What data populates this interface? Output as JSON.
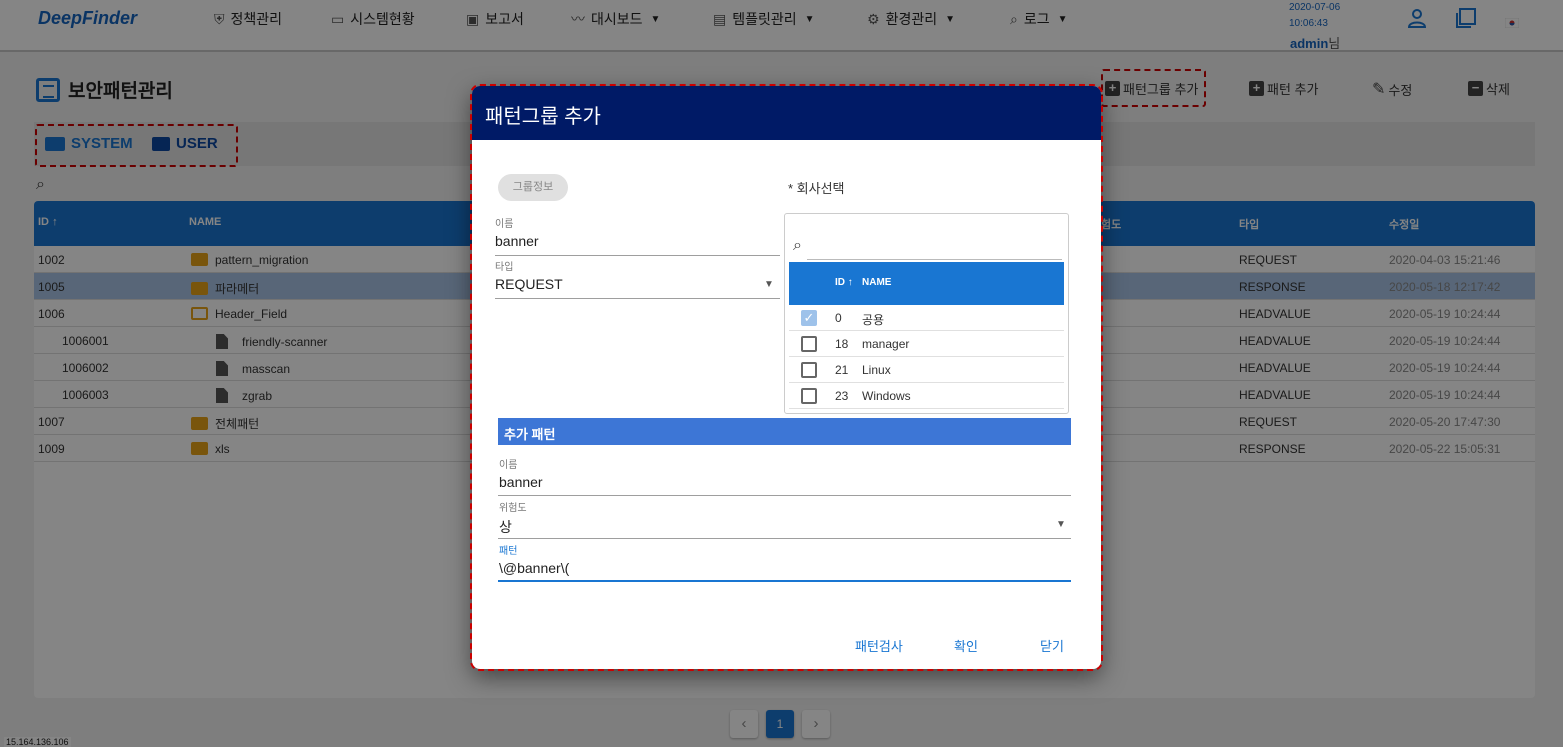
{
  "app": {
    "logo": "DeepFinder"
  },
  "nav": [
    {
      "label": "정책관리",
      "icon": "shield-icon",
      "glyph": "⛨",
      "caret": false
    },
    {
      "label": "시스템현황",
      "icon": "monitor-icon",
      "glyph": "▭",
      "caret": false
    },
    {
      "label": "보고서",
      "icon": "clipboard-check-icon",
      "glyph": "▣",
      "caret": false
    },
    {
      "label": "대시보드",
      "icon": "trend-icon",
      "glyph": "〰",
      "caret": true
    },
    {
      "label": "템플릿관리",
      "icon": "template-icon",
      "glyph": "▤",
      "caret": true
    },
    {
      "label": "환경관리",
      "icon": "gear-icon",
      "glyph": "⚙",
      "caret": true
    },
    {
      "label": "로그",
      "icon": "search-icon",
      "glyph": "⌕",
      "caret": true
    }
  ],
  "header": {
    "date": "2020-07-06",
    "time": "10:06:43",
    "user": "admin",
    "user_suffix": "님"
  },
  "page": {
    "title": "보안패턴관리"
  },
  "actions": {
    "add_group": "패턴그룹 추가",
    "add_pattern": "패턴 추가",
    "edit": "수정",
    "delete": "삭제"
  },
  "tabs": {
    "system": "SYSTEM",
    "user": "USER"
  },
  "table": {
    "columns": {
      "id": "ID",
      "name": "NAME",
      "risk": "험도",
      "type": "타입",
      "modified": "수정일"
    },
    "rows": [
      {
        "id": "1002",
        "name": "pattern_migration",
        "type": "REQUEST",
        "modified": "2020-04-03 15:21:46",
        "kind": "folder",
        "level": 0,
        "selected": false
      },
      {
        "id": "1005",
        "name": "파라메터",
        "type": "RESPONSE",
        "modified": "2020-05-18 12:17:42",
        "kind": "folder",
        "level": 0,
        "selected": true
      },
      {
        "id": "1006",
        "name": "Header_Field",
        "type": "HEADVALUE",
        "modified": "2020-05-19 10:24:44",
        "kind": "folder-open",
        "level": 0,
        "selected": false
      },
      {
        "id": "1006001",
        "name": "friendly-scanner",
        "type": "HEADVALUE",
        "modified": "2020-05-19 10:24:44",
        "kind": "file",
        "level": 1,
        "selected": false
      },
      {
        "id": "1006002",
        "name": "masscan",
        "type": "HEADVALUE",
        "modified": "2020-05-19 10:24:44",
        "kind": "file",
        "level": 1,
        "selected": false
      },
      {
        "id": "1006003",
        "name": "zgrab",
        "type": "HEADVALUE",
        "modified": "2020-05-19 10:24:44",
        "kind": "file",
        "level": 1,
        "selected": false
      },
      {
        "id": "1007",
        "name": "전체패턴",
        "type": "REQUEST",
        "modified": "2020-05-20 17:47:30",
        "kind": "folder",
        "level": 0,
        "selected": false
      },
      {
        "id": "1009",
        "name": "xls",
        "type": "RESPONSE",
        "modified": "2020-05-22 15:05:31",
        "kind": "folder",
        "level": 0,
        "selected": false
      }
    ]
  },
  "pagination": {
    "current": "1",
    "prev": "‹",
    "next": "›"
  },
  "footer": {
    "ip": "15.164.136.106"
  },
  "dialog": {
    "title": "패턴그룹 추가",
    "group_info_chip": "그룹정보",
    "name_label": "이름",
    "name_value": "banner",
    "type_label": "타입",
    "type_value": "REQUEST",
    "company_title": "* 회사선택",
    "company_table": {
      "col_id": "ID",
      "col_name": "NAME",
      "rows": [
        {
          "id": "0",
          "name": "공용",
          "checked": true
        },
        {
          "id": "18",
          "name": "manager",
          "checked": false
        },
        {
          "id": "21",
          "name": "Linux",
          "checked": false
        },
        {
          "id": "23",
          "name": "Windows",
          "checked": false
        }
      ]
    },
    "section_title": "추가 패턴",
    "pattern_name_label": "이름",
    "pattern_name_value": "banner",
    "risk_label": "위험도",
    "risk_value": "상",
    "pattern_label": "패턴",
    "pattern_value": "\\@banner\\(",
    "buttons": {
      "check": "패턴검사",
      "confirm": "확인",
      "close": "닫기"
    }
  }
}
